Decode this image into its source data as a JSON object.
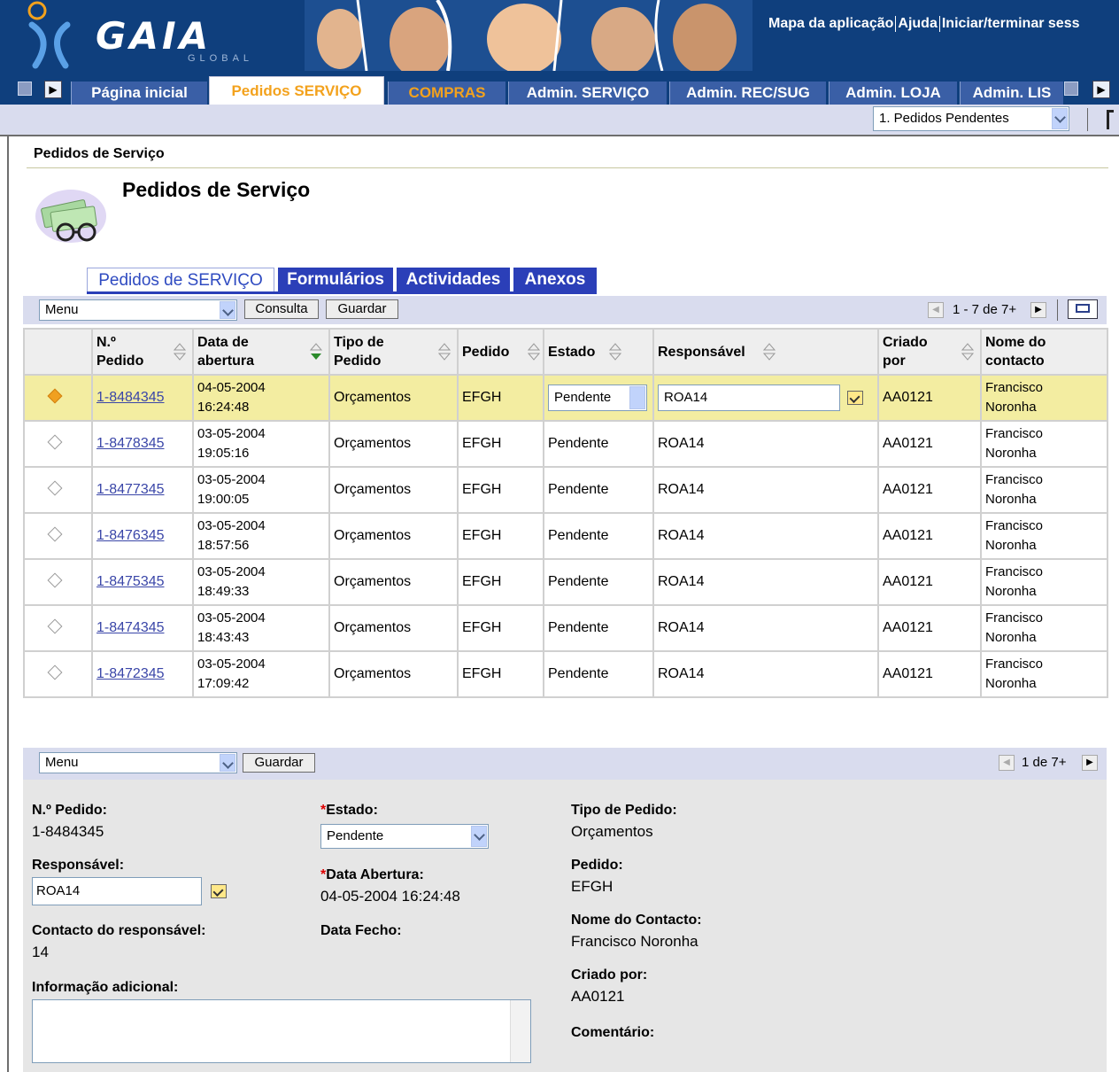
{
  "header": {
    "logo_text": "GAIA",
    "logo_sub": "GLOBAL",
    "links": [
      "Mapa da aplicação",
      "Ajuda",
      "Iniciar/terminar sess"
    ]
  },
  "tabs": [
    {
      "label": "Página inicial"
    },
    {
      "label": "Pedidos SERVIÇO"
    },
    {
      "label": "COMPRAS"
    },
    {
      "label": "Admin. SERVIÇO"
    },
    {
      "label": "Admin. REC/SUG"
    },
    {
      "label": "Admin. LOJA"
    },
    {
      "label": "Admin. LIS"
    }
  ],
  "view_select": "1. Pedidos Pendentes",
  "breadcrumb": "Pedidos de Serviço",
  "page_title": "Pedidos de Serviço",
  "subtabs": [
    "Pedidos de SERVIÇO",
    "Formulários",
    "Actividades",
    "Anexos"
  ],
  "list_toolbar": {
    "menu": "Menu",
    "query": "Consulta",
    "save": "Guardar",
    "pager": "1 - 7 de 7+"
  },
  "columns": [
    {
      "l1": "N.º",
      "l2": "Pedido"
    },
    {
      "l1": "Data de",
      "l2": "abertura"
    },
    {
      "l1": "Tipo de",
      "l2": "Pedido"
    },
    {
      "l1": "Pedido",
      "l2": ""
    },
    {
      "l1": "Estado",
      "l2": ""
    },
    {
      "l1": "Responsável",
      "l2": ""
    },
    {
      "l1": "Criado",
      "l2": "por"
    },
    {
      "l1": "Nome do",
      "l2": "contacto"
    }
  ],
  "rows": [
    {
      "id": "1-8484345",
      "d": "04-05-2004",
      "t": "16:24:48",
      "tipo": "Orçamentos",
      "pedido": "EFGH",
      "estado": "Pendente",
      "resp": "ROA14",
      "criado": "AA0121",
      "c1": "Francisco",
      "c2": "Noronha"
    },
    {
      "id": "1-8478345",
      "d": "03-05-2004",
      "t": "19:05:16",
      "tipo": "Orçamentos",
      "pedido": "EFGH",
      "estado": "Pendente",
      "resp": "ROA14",
      "criado": "AA0121",
      "c1": "Francisco",
      "c2": "Noronha"
    },
    {
      "id": "1-8477345",
      "d": "03-05-2004",
      "t": "19:00:05",
      "tipo": "Orçamentos",
      "pedido": "EFGH",
      "estado": "Pendente",
      "resp": "ROA14",
      "criado": "AA0121",
      "c1": "Francisco",
      "c2": "Noronha"
    },
    {
      "id": "1-8476345",
      "d": "03-05-2004",
      "t": "18:57:56",
      "tipo": "Orçamentos",
      "pedido": "EFGH",
      "estado": "Pendente",
      "resp": "ROA14",
      "criado": "AA0121",
      "c1": "Francisco",
      "c2": "Noronha"
    },
    {
      "id": "1-8475345",
      "d": "03-05-2004",
      "t": "18:49:33",
      "tipo": "Orçamentos",
      "pedido": "EFGH",
      "estado": "Pendente",
      "resp": "ROA14",
      "criado": "AA0121",
      "c1": "Francisco",
      "c2": "Noronha"
    },
    {
      "id": "1-8474345",
      "d": "03-05-2004",
      "t": "18:43:43",
      "tipo": "Orçamentos",
      "pedido": "EFGH",
      "estado": "Pendente",
      "resp": "ROA14",
      "criado": "AA0121",
      "c1": "Francisco",
      "c2": "Noronha"
    },
    {
      "id": "1-8472345",
      "d": "03-05-2004",
      "t": "17:09:42",
      "tipo": "Orçamentos",
      "pedido": "EFGH",
      "estado": "Pendente",
      "resp": "ROA14",
      "criado": "AA0121",
      "c1": "Francisco",
      "c2": "Noronha"
    }
  ],
  "form_toolbar": {
    "menu": "Menu",
    "save": "Guardar",
    "pager": "1 de 7+"
  },
  "form": {
    "num_label": "N.º Pedido:",
    "num_value": "1-8484345",
    "resp_label": "Responsável:",
    "resp_value": "ROA14",
    "contact_label": "Contacto do responsável:",
    "contact_value": "14",
    "info_label": "Informação adicional:",
    "estado_label": "Estado:",
    "estado_value": "Pendente",
    "abertura_label": "Data Abertura:",
    "abertura_value": "04-05-2004 16:24:48",
    "fecho_label": "Data Fecho:",
    "tipo_label": "Tipo de Pedido:",
    "tipo_value": "Orçamentos",
    "pedido_label": "Pedido:",
    "pedido_value": "EFGH",
    "nome_label": "Nome do Contacto:",
    "nome_value": "Francisco Noronha",
    "criado_label": "Criado por:",
    "criado_value": "AA0121",
    "comentario_label": "Comentário:",
    "required_mark": "*"
  },
  "colors": {
    "header": "#0f3f7d",
    "accent": "#f3a21d",
    "subtab": "#2b3fb8",
    "selected_row": "#f3eda1"
  }
}
